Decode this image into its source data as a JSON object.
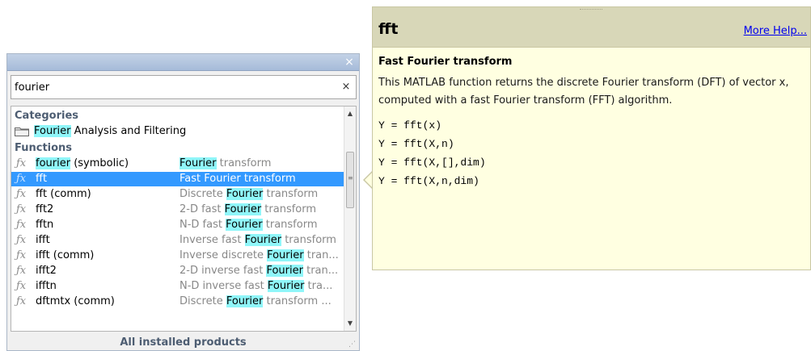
{
  "browser": {
    "search": {
      "value": "fourier",
      "clear_label": "×"
    },
    "close_label": "×",
    "categories_header": "Categories",
    "category": {
      "pre": "",
      "highlight": "Fourier",
      "post": " Analysis and Filtering"
    },
    "functions_header": "Functions",
    "functions": [
      {
        "icon": "fx",
        "name_pre": "",
        "name_hl": "fourier",
        "name_post": " (symbolic)",
        "desc_pre": "",
        "desc_hl": "Fourier",
        "desc_post": " transform",
        "selected": false
      },
      {
        "icon": "fx",
        "name_pre": "fft",
        "name_hl": "",
        "name_post": "",
        "desc_pre": "Fast Fourier transform",
        "desc_hl": "",
        "desc_post": "",
        "selected": true
      },
      {
        "icon": "fx",
        "name_pre": "fft (comm)",
        "name_hl": "",
        "name_post": "",
        "desc_pre": "Discrete ",
        "desc_hl": "Fourier",
        "desc_post": " transform",
        "selected": false
      },
      {
        "icon": "fx",
        "name_pre": "fft2",
        "name_hl": "",
        "name_post": "",
        "desc_pre": "2-D fast ",
        "desc_hl": "Fourier",
        "desc_post": " transform",
        "selected": false
      },
      {
        "icon": "fx",
        "name_pre": "fftn",
        "name_hl": "",
        "name_post": "",
        "desc_pre": "N-D fast ",
        "desc_hl": "Fourier",
        "desc_post": " transform",
        "selected": false
      },
      {
        "icon": "fx",
        "name_pre": "ifft",
        "name_hl": "",
        "name_post": "",
        "desc_pre": "Inverse fast ",
        "desc_hl": "Fourier",
        "desc_post": " transform",
        "selected": false
      },
      {
        "icon": "fx",
        "name_pre": "ifft (comm)",
        "name_hl": "",
        "name_post": "",
        "desc_pre": "Inverse discrete ",
        "desc_hl": "Fourier",
        "desc_post": " tran...",
        "selected": false
      },
      {
        "icon": "fx",
        "name_pre": "ifft2",
        "name_hl": "",
        "name_post": "",
        "desc_pre": "2-D inverse fast ",
        "desc_hl": "Fourier",
        "desc_post": " tran...",
        "selected": false
      },
      {
        "icon": "fx",
        "name_pre": "ifftn",
        "name_hl": "",
        "name_post": "",
        "desc_pre": "N-D inverse fast ",
        "desc_hl": "Fourier",
        "desc_post": " tra...",
        "selected": false
      },
      {
        "icon": "fx",
        "name_pre": "dftmtx (comm)",
        "name_hl": "",
        "name_post": "",
        "desc_pre": "Discrete ",
        "desc_hl": "Fourier",
        "desc_post": " transform ...",
        "selected": false
      }
    ],
    "footer": "All installed products"
  },
  "help": {
    "title": "fft",
    "more_help": "More Help...",
    "summary": "Fast Fourier transform",
    "description": "This MATLAB function returns the discrete Fourier transform (DFT) of vector x, computed with a fast Fourier transform (FFT) algorithm.",
    "syntax": [
      "Y = fft(x)",
      "Y = fft(X,n)",
      "Y = fft(X,[],dim)",
      "Y = fft(X,n,dim)"
    ]
  },
  "colors": {
    "highlight": "#8ff6f9",
    "selection": "#3399ff",
    "tooltip_bg": "#ffffe1",
    "tooltip_header": "#d8d7b8",
    "link": "#0000ee"
  }
}
